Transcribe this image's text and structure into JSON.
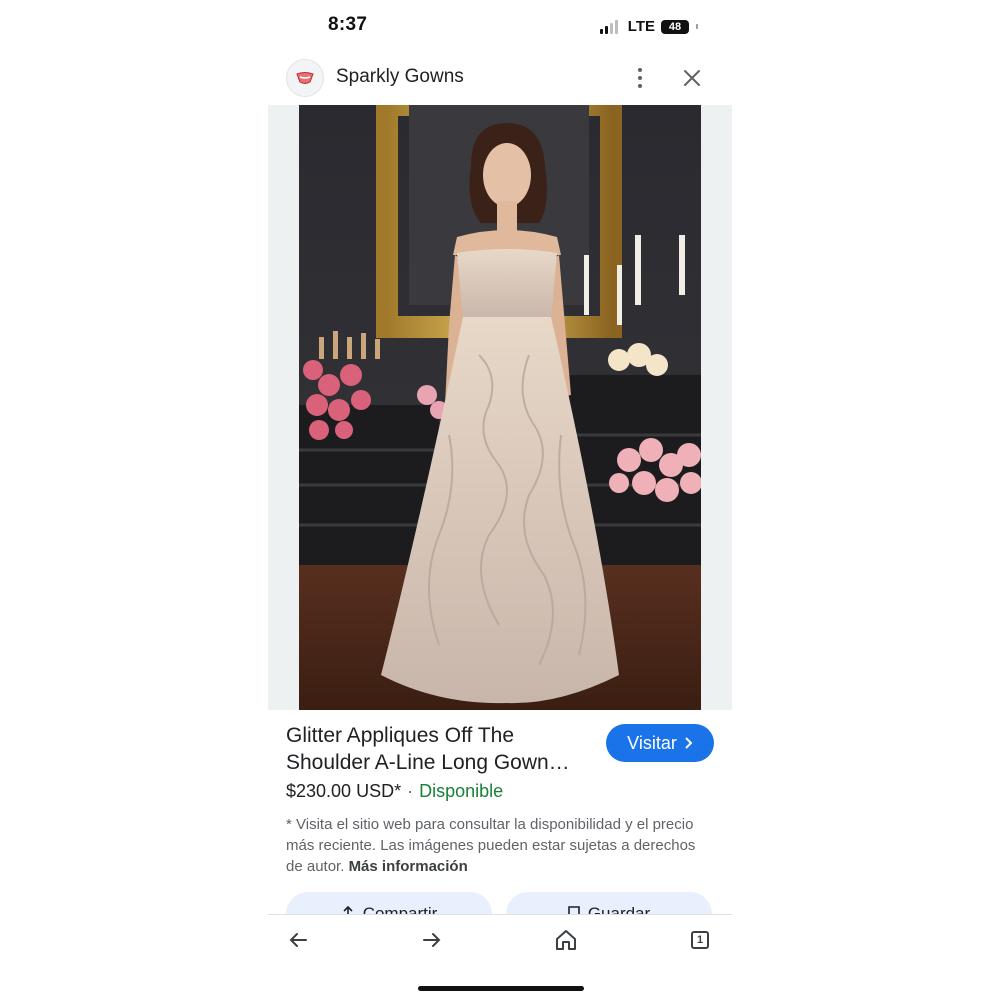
{
  "status_bar": {
    "time": "8:37",
    "network": "LTE",
    "battery": "48"
  },
  "header": {
    "site_name": "Sparkly Gowns",
    "menu_icon": "more-vert-icon",
    "close_icon": "close-icon"
  },
  "product": {
    "title_line1": "Glitter Appliques Off The",
    "title_line2": "Shoulder A-Line Long Gown…",
    "visit_label": "Visitar",
    "price": "$230.00 USD*",
    "separator": "·",
    "availability": "Disponible",
    "disclaimer": "* Visita el sitio web para consultar la disponibilidad y el precio más reciente. Las imágenes pueden estar sujetas a derechos de autor.",
    "more_info": "Más información"
  },
  "actions": {
    "share_label": "Compartir",
    "save_label": "Guardar"
  },
  "bottom_nav": {
    "tab_count": "1"
  },
  "colors": {
    "accent": "#1a73e8",
    "available": "#188038",
    "action_bg": "#e8f0fe"
  }
}
